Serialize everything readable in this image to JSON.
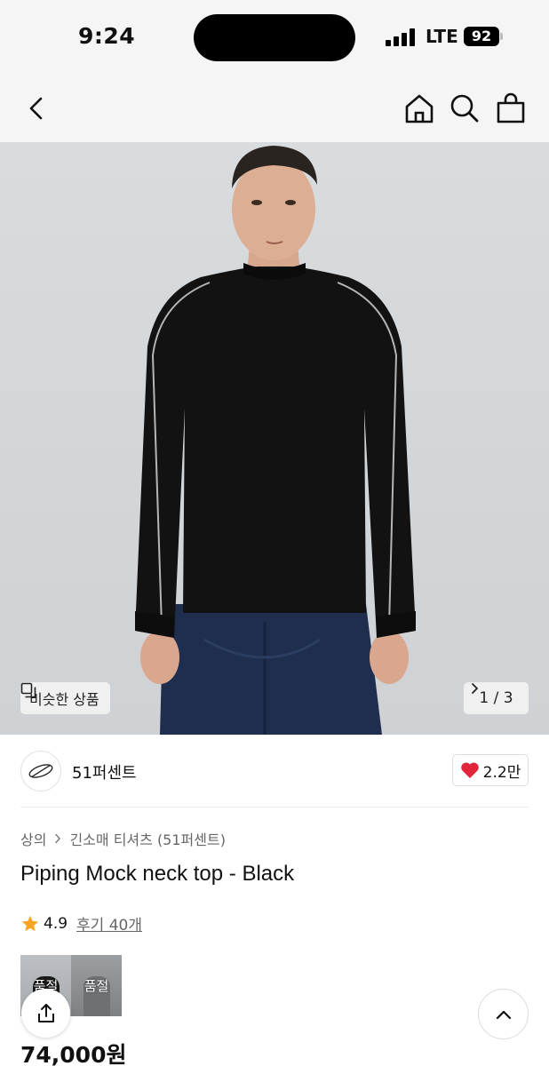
{
  "status_bar": {
    "time": "9:24",
    "network": "LTE",
    "battery": "92"
  },
  "nav": {
    "back_icon": "chevron-left-icon",
    "home_icon": "home-icon",
    "search_icon": "search-icon",
    "cart_icon": "shopping-bag-icon"
  },
  "gallery": {
    "similar_label": "비슷한 상품",
    "counter": "1 / 3"
  },
  "brand": {
    "name": "51퍼센트",
    "likes": "2.2만"
  },
  "product": {
    "breadcrumb": [
      "상의",
      "긴소매 티셔츠 (51퍼센트)"
    ],
    "title": "Piping Mock neck top - Black",
    "rating": "4.9",
    "reviews": "후기 40개",
    "thumbs": [
      {
        "badge": "품절"
      },
      {
        "badge": "품절"
      }
    ],
    "price": "74,000원"
  },
  "colors": {
    "like_heart": "#e0243a",
    "star": "#f6a623"
  }
}
